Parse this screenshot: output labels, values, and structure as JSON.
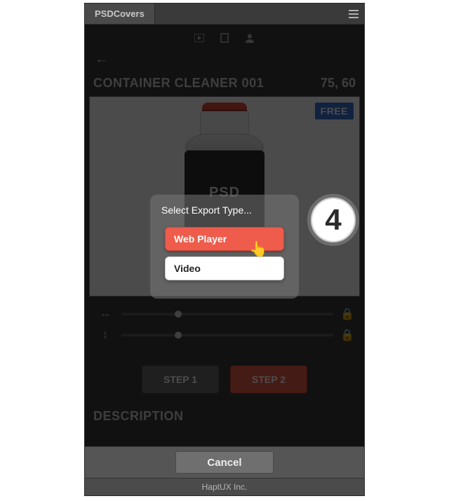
{
  "header": {
    "app_name": "PSDCovers"
  },
  "title": {
    "name": "CONTAINER CLEANER 001",
    "coords": "75, 60"
  },
  "badge": {
    "free": "FREE"
  },
  "product_label": "PSD",
  "sliders": {
    "thumb1_left_pct": 25,
    "thumb2_left_pct": 25
  },
  "steps": {
    "step1": "STEP 1",
    "step2": "STEP 2"
  },
  "section": {
    "description": "DESCRIPTION"
  },
  "modal": {
    "title": "Select Export Type...",
    "option_primary": "Web Player",
    "option_secondary": "Video"
  },
  "footer": {
    "cancel": "Cancel",
    "credit": "HaptUX Inc."
  },
  "callout": {
    "number": "4"
  }
}
